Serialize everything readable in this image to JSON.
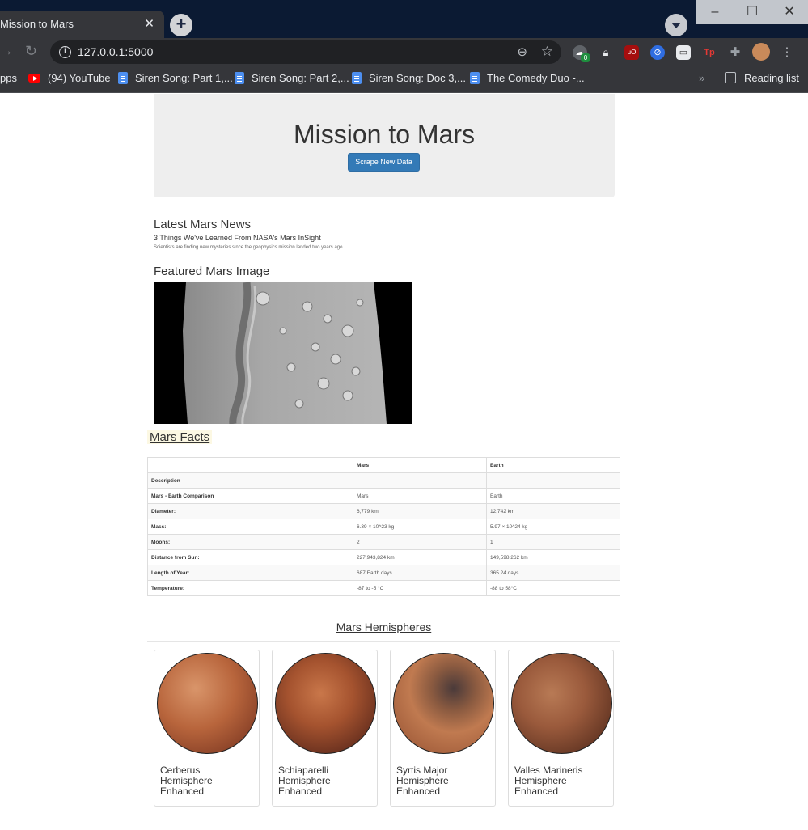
{
  "browser": {
    "tab_title": "Mission to Mars",
    "tab_close": "✕",
    "new_tab": "+",
    "url": "127.0.0.1:5000",
    "window_minimize": "–",
    "window_maximize": "☐",
    "window_close": "✕",
    "ext_badge": "0",
    "bookmarks": [
      {
        "label": "pps",
        "icon": "none"
      },
      {
        "label": "(94) YouTube",
        "icon": "youtube-icon"
      },
      {
        "label": "Siren Song: Part 1,...",
        "icon": "doc-icon"
      },
      {
        "label": "Siren Song: Part 2,...",
        "icon": "doc-icon"
      },
      {
        "label": "Siren Song: Doc 3,...",
        "icon": "doc-icon"
      },
      {
        "label": "The Comedy Duo -...",
        "icon": "doc-icon"
      }
    ],
    "bookmarks_overflow": "»",
    "reading_list": "Reading list"
  },
  "page": {
    "title": "Mission to Mars",
    "scrape_button": "Scrape New Data",
    "news_heading": "Latest Mars News",
    "news_title": "3 Things We've Learned From NASA's Mars InSight",
    "news_paragraph": "Scientists are finding new mysteries since the geophysics mission landed two years ago.",
    "image_heading": "Featured Mars Image",
    "facts_heading": "Mars Facts",
    "facts_table": {
      "headers": [
        "",
        "Mars",
        "Earth"
      ],
      "rows": [
        [
          "Description",
          "",
          ""
        ],
        [
          "Mars - Earth Comparison",
          "Mars",
          "Earth"
        ],
        [
          "Diameter:",
          "6,779 km",
          "12,742 km"
        ],
        [
          "Mass:",
          "6.39 × 10^23 kg",
          "5.97 × 10^24 kg"
        ],
        [
          "Moons:",
          "2",
          "1"
        ],
        [
          "Distance from Sun:",
          "227,943,824 km",
          "149,598,262 km"
        ],
        [
          "Length of Year:",
          "687 Earth days",
          "365.24 days"
        ],
        [
          "Temperature:",
          "-87 to -5 °C",
          "-88 to 58°C"
        ]
      ]
    },
    "hemispheres_heading": "Mars Hemispheres",
    "hemispheres": [
      {
        "title": "Cerberus Hemisphere Enhanced"
      },
      {
        "title": "Schiaparelli Hemisphere Enhanced"
      },
      {
        "title": "Syrtis Major Hemisphere Enhanced"
      },
      {
        "title": "Valles Marineris Hemisphere Enhanced"
      }
    ]
  },
  "colors": {
    "titlebar": "#0b1a33",
    "toolbar": "#35363a",
    "jumbotron": "#eeeeee",
    "button": "#337ab7",
    "highlight": "#fcf8e3"
  }
}
